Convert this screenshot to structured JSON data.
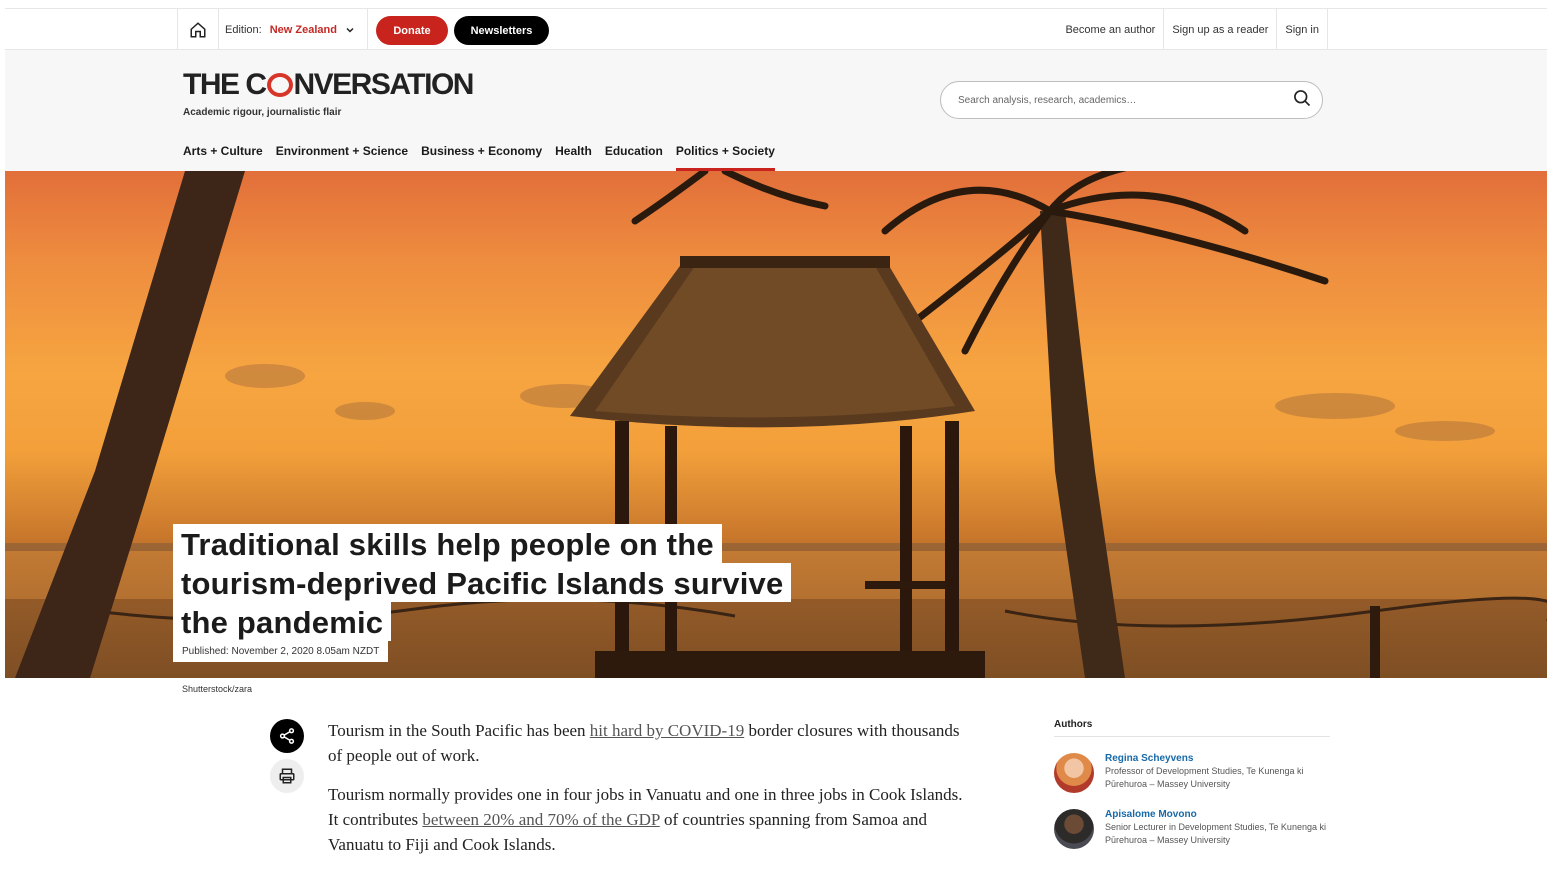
{
  "topbar": {
    "edition_label": "Edition:",
    "edition_value": "New Zealand",
    "donate": "Donate",
    "newsletters": "Newsletters",
    "links": [
      "Become an author",
      "Sign up as a reader",
      "Sign in"
    ]
  },
  "header": {
    "logo_pre": "THE C",
    "logo_post": "NVERSATION",
    "tagline": "Academic rigour, journalistic flair",
    "search_placeholder": "Search analysis, research, academics…",
    "nav": [
      "Arts + Culture",
      "Environment + Science",
      "Business + Economy",
      "Health",
      "Education",
      "Politics + Society"
    ],
    "active_nav": "Politics + Society"
  },
  "hero": {
    "headline_lines": [
      "Traditional skills help people on the",
      "tourism-deprived Pacific Islands survive",
      "the pandemic"
    ],
    "published": "Published: November 2, 2020 8.05am NZDT",
    "credit": "Shutterstock/zara"
  },
  "article": {
    "p1_a": "Tourism in the South Pacific has been ",
    "p1_link": "hit hard by COVID-19",
    "p1_b": " border closures with thousands of people out of work.",
    "p2_a": "Tourism normally provides one in four jobs in Vanuatu and one in three jobs in Cook Islands. It contributes ",
    "p2_link": "between 20% and 70% of the GDP",
    "p2_b": " of countries spanning from Samoa and Vanuatu to Fiji and Cook Islands."
  },
  "authors": {
    "heading": "Authors",
    "list": [
      {
        "name": "Regina Scheyvens",
        "role": "Professor of Development Studies, Te Kunenga ki Pūrehuroa – Massey University"
      },
      {
        "name": "Apisalome Movono",
        "role": "Senior Lecturer in Development Studies, Te Kunenga ki Pūrehuroa – Massey University"
      }
    ]
  },
  "colors": {
    "brand_red": "#c8231c",
    "link_blue": "#1769a8"
  }
}
